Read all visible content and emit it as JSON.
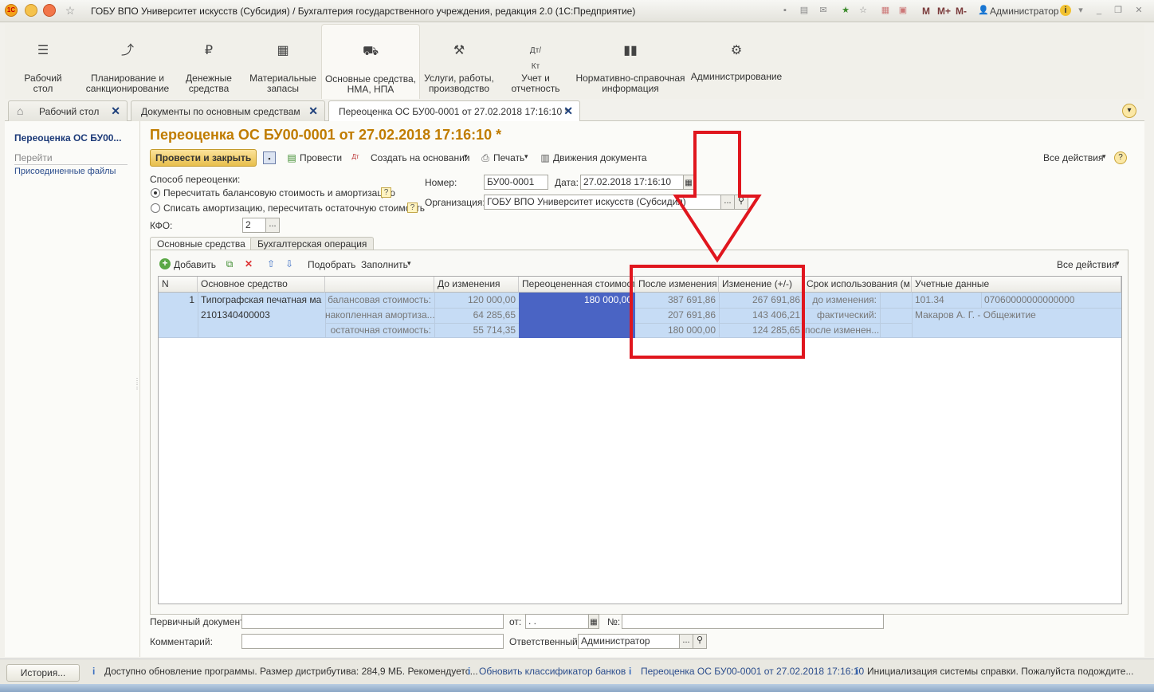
{
  "window": {
    "title": "ГОБУ ВПО Университет искусств (Субсидия) / Бухгалтерия государственного учреждения, редакция 2.0  (1С:Предприятие)",
    "m_labels": [
      "M",
      "M+",
      "M-"
    ],
    "user": "Администратор"
  },
  "sections": [
    {
      "label": "Рабочий\nстол",
      "icon": "menu-icon"
    },
    {
      "label": "Планирование и\nсанкционирование",
      "icon": "chart-icon"
    },
    {
      "label": "Денежные\nсредства",
      "icon": "ruble-icon"
    },
    {
      "label": "Материальные\nзапасы",
      "icon": "grid-icon"
    },
    {
      "label": "Основные средства,\nНМА, НПА",
      "icon": "truck-icon"
    },
    {
      "label": "Услуги, работы,\nпроизводство",
      "icon": "tools-icon"
    },
    {
      "label": "Учет и\nотчетность",
      "icon": "dt-kt-icon"
    },
    {
      "label": "Нормативно-справочная\nинформация",
      "icon": "books-icon"
    },
    {
      "label": "Администрирование",
      "icon": "gear-icon"
    }
  ],
  "tabs": [
    {
      "label": "Рабочий стол"
    },
    {
      "label": "Документы по основным средствам"
    },
    {
      "label": "Переоценка ОС БУ00-0001 от 27.02.2018 17:16:10 *"
    }
  ],
  "left_panel": {
    "title": "Переоценка ОС БУ00...",
    "goto": "Перейти",
    "files": "Присоединенные файлы"
  },
  "form": {
    "title": "Переоценка ОС БУ00-0001 от 27.02.2018 17:16:10 *",
    "toolbar": {
      "post_close": "Провести и закрыть",
      "post": "Провести",
      "create_based": "Создать на основании",
      "print": "Печать",
      "movements": "Движения документа",
      "all_actions": "Все действия"
    },
    "method_label": "Способ переоценки:",
    "method_option1": "Пересчитать балансовую стоимость и амортизацию",
    "method_option2": "Списать амортизацию, пересчитать остаточную стоимость",
    "kfo_label": "КФО:",
    "kfo_value": "2",
    "number_label": "Номер:",
    "number_value": "БУ00-0001",
    "date_label": "Дата:",
    "date_value": "27.02.2018 17:16:10",
    "org_label": "Организация:",
    "org_value": "ГОБУ ВПО Университет искусств (Субсидия)"
  },
  "inner_tabs": [
    "Основные средства",
    "Бухгалтерская операция"
  ],
  "grid_toolbar": {
    "add": "Добавить",
    "pick": "Подобрать",
    "fill": "Заполнить",
    "all_actions": "Все действия"
  },
  "grid": {
    "headers": [
      "N",
      "Основное средство",
      "",
      "До изменения",
      "Переоцененная стоимость",
      "После изменения",
      "Изменение (+/-)",
      "Срок использования (м...",
      "Учетные данные"
    ],
    "row": {
      "n": "1",
      "asset_name": "Типографская печатная ма...",
      "asset_code": "2101340400003",
      "kinds": [
        "балансовая стоимость:",
        "накопленная амортиза...",
        "остаточная стоимость:"
      ],
      "before": [
        "120 000,00",
        "64 285,65",
        "55 714,35"
      ],
      "revalued": "180 000,00",
      "after": [
        "387 691,86",
        "207 691,86",
        "180 000,00"
      ],
      "change": [
        "267 691,86",
        "143 406,21",
        "124 285,65"
      ],
      "term_kinds": [
        "до изменения:",
        "фактический:",
        "после изменен..."
      ],
      "account": "101.34",
      "kbk": "07060000000000000",
      "responsible": "Макаров А. Г. - Общежитие"
    }
  },
  "bottom": {
    "primary_doc_label": "Первичный документ:",
    "from_label": "от:",
    "from_value": " .  .",
    "no_label": "№:",
    "comment_label": "Комментарий:",
    "responsible_label": "Ответственный:",
    "responsible_value": "Администратор"
  },
  "status": {
    "history": "История...",
    "items": [
      "Доступно обновление программы. Размер дистрибутива: 284,9 МБ. Рекомендуетс...",
      "Обновить классификатор банков",
      "Переоценка ОС БУ00-0001 от 27.02.2018 17:16:10",
      "Инициализация системы справки. Пожалуйста подождите..."
    ]
  },
  "colors": {
    "accent_title": "#c07c00",
    "link": "#2a4c8c",
    "selection": "#c6dcf5",
    "revalued_cell": "#4a64c4",
    "annotation": "#e0161e"
  }
}
